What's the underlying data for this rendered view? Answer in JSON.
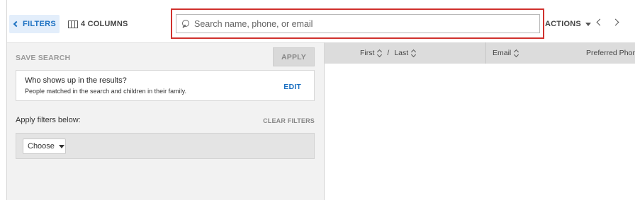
{
  "toolbar": {
    "filters_label": "FILTERS",
    "columns_label": "4 COLUMNS",
    "search_placeholder": "Search name, phone, or email",
    "search_value": "",
    "actions_label": "ACTIONS"
  },
  "filter_panel": {
    "save_search_label": "SAVE SEARCH",
    "apply_label": "APPLY",
    "results_card": {
      "title": "Who shows up in the results?",
      "description": "People matched in the search and children in their family.",
      "edit_label": "EDIT"
    },
    "apply_filters_label": "Apply filters below:",
    "clear_filters_label": "CLEAR FILTERS",
    "choose_label": "Choose"
  },
  "table": {
    "columns": {
      "first": "First",
      "separator": "/",
      "last": "Last",
      "email": "Email",
      "preferred_phone": "Preferred Phone"
    }
  },
  "colors": {
    "accent": "#1a6fc1",
    "highlight": "#d0312d",
    "header_bg": "#dcdcdc",
    "panel_bg": "#f2f2f2"
  }
}
